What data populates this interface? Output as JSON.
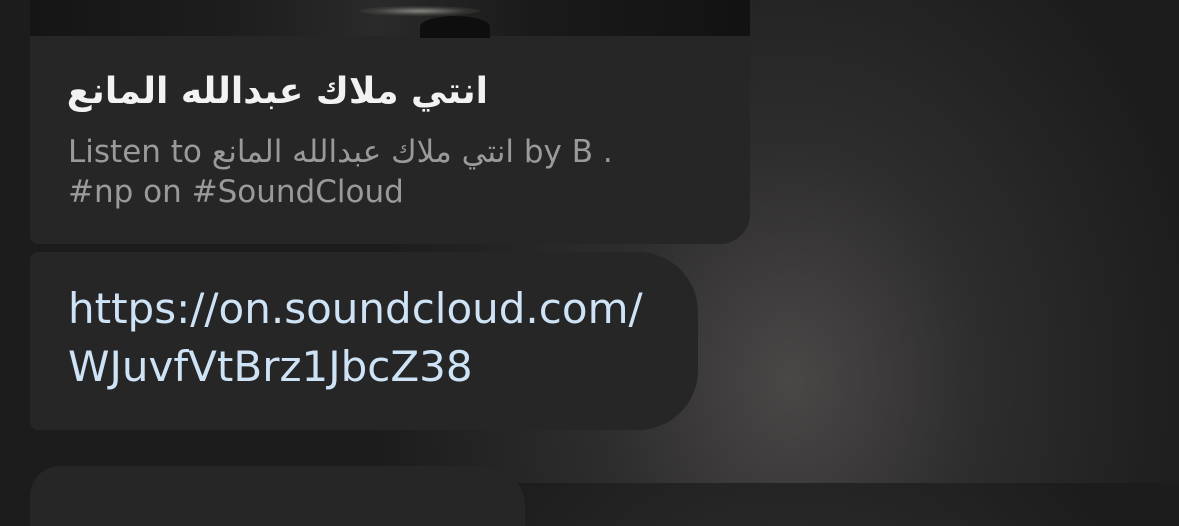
{
  "preview_card": {
    "title": "انتي ملاك عبدالله المانع",
    "description_line1": "Listen to انتي ملاك عبدالله المانع by B .",
    "description_line2": "#np on #SoundCloud"
  },
  "link_message": {
    "url_line1": "https://on.soundcloud.com/",
    "url_line2": "WJuvfVtBrz1JbcZ38"
  }
}
